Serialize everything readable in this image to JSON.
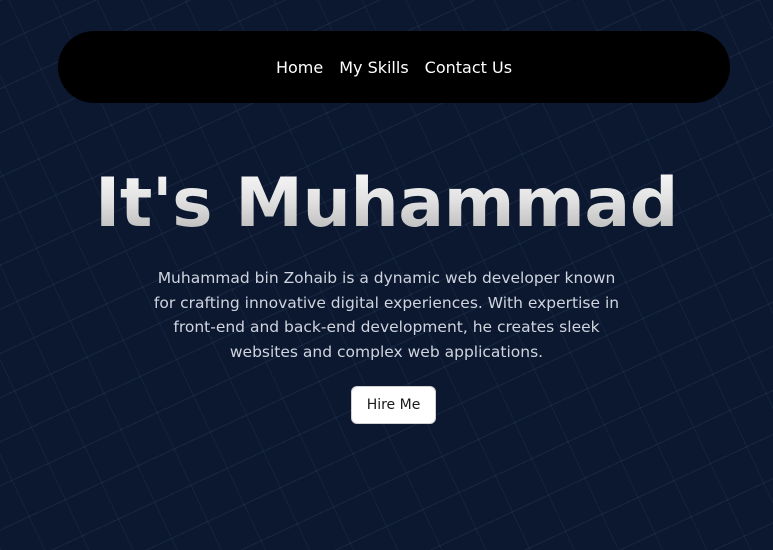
{
  "nav": {
    "items": [
      {
        "label": "Home"
      },
      {
        "label": "My Skills"
      },
      {
        "label": "Contact Us"
      }
    ]
  },
  "hero": {
    "title": "It's Muhammad",
    "description": "Muhammad bin Zohaib is a dynamic web developer known for crafting innovative digital experiences. With expertise in front-end and back-end development, he creates sleek websites and complex web applications.",
    "cta_label": "Hire Me"
  },
  "colors": {
    "background": "#0b1830",
    "navbar": "#000000",
    "button": "#ffffff"
  }
}
